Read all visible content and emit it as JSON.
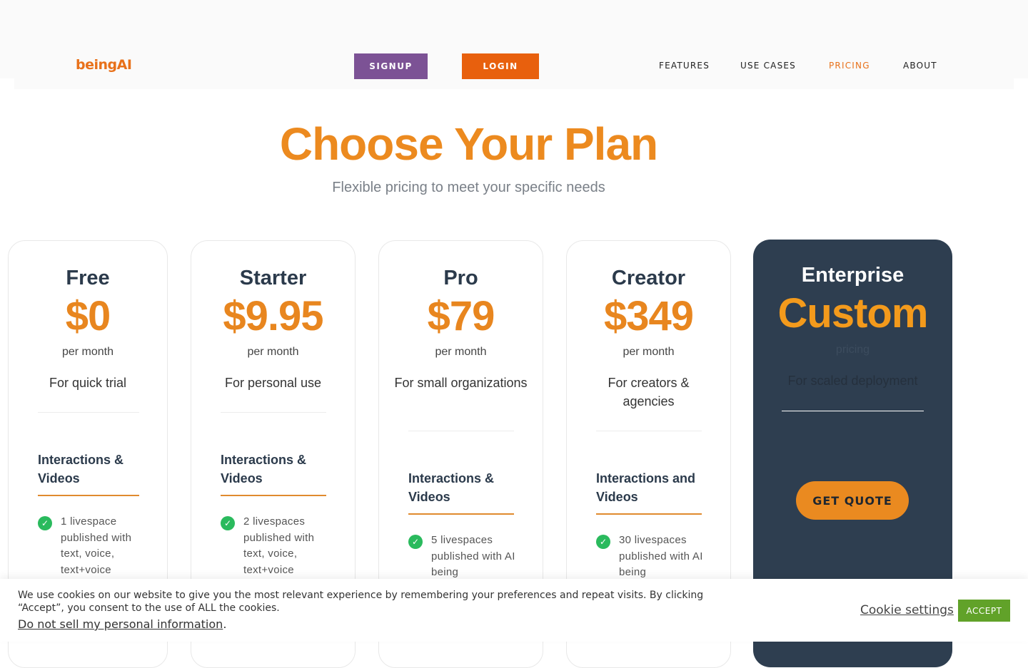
{
  "header": {
    "logo": "beingAI",
    "signup_label": "SIGNUP",
    "login_label": "LOGIN",
    "nav": [
      "FEATURES",
      "USE CASES",
      "PRICING",
      "ABOUT"
    ],
    "active_nav": "PRICING"
  },
  "hero": {
    "title": "Choose Your Plan",
    "subtitle": "Flexible pricing to meet your specific needs"
  },
  "plans": [
    {
      "name": "Free",
      "price": "$0",
      "period": "per month",
      "description": "For quick trial",
      "feature_title": "Interactions & Videos",
      "feature_item": "1 livespace published with text, voice, text+voice"
    },
    {
      "name": "Starter",
      "price": "$9.95",
      "period": "per month",
      "description": "For personal use",
      "feature_title": "Interactions & Videos",
      "feature_item": "2 livespaces published with text, voice, text+voice"
    },
    {
      "name": "Pro",
      "price": "$79",
      "period": "per month",
      "description": "For small organizations",
      "feature_title": "Interactions & Videos",
      "feature_item": "5 livespaces published with AI being"
    },
    {
      "name": "Creator",
      "price": "$349",
      "period": "per month",
      "description": "For creators & agencies",
      "feature_title": "Interactions and Videos",
      "feature_item": "30 livespaces published with AI being"
    },
    {
      "name": "Enterprise",
      "price": "Custom",
      "period": "pricing",
      "description": "For scaled deployment",
      "cta": "GET QUOTE"
    }
  ],
  "cookie_banner": {
    "text": "We use cookies on our website to give you the most relevant experience by remembering your preferences and repeat visits. By clicking “Accept”, you consent to the use of ALL the cookies.",
    "link": "Do not sell my personal information",
    "link_suffix": ".",
    "settings_label": "Cookie settings",
    "accept_label": "ACCEPT"
  },
  "colors": {
    "accent_orange": "#e8861f",
    "signup_purple": "#7c5295",
    "login_orange": "#e8600d",
    "dark_card": "#2e3e50",
    "check_green": "#2aba5d",
    "accept_green": "#61a229"
  }
}
